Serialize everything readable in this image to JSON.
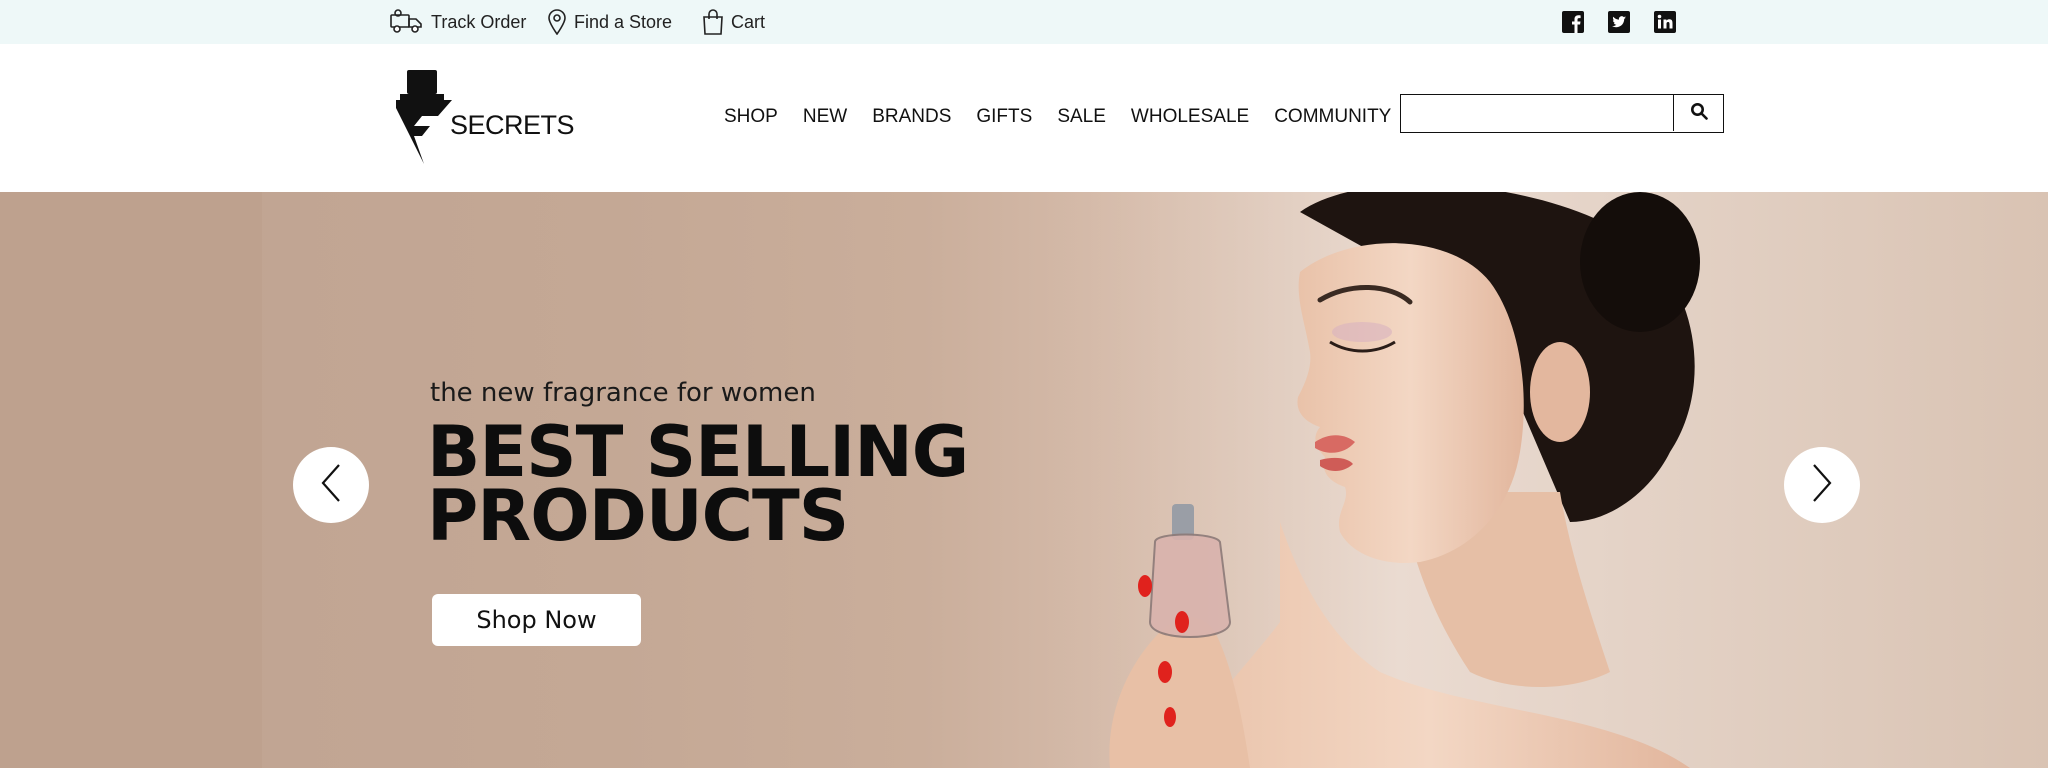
{
  "topbar": {
    "track_order": "Track Order",
    "find_store": "Find a Store",
    "cart": "Cart"
  },
  "header": {
    "logo_text": "SECRETS",
    "nav": [
      "SHOP",
      "NEW",
      "BRANDS",
      "GIFTS",
      "SALE",
      "WHOLESALE",
      "COMMUNITY"
    ],
    "search": {
      "placeholder": "",
      "value": ""
    }
  },
  "hero": {
    "subtitle": "the new fragrance for women",
    "headline_line1": "BEST SELLING",
    "headline_line2": "PRODUCTS",
    "cta": "Shop Now"
  },
  "icons": {
    "track": "truck-icon",
    "store": "map-pin-icon",
    "cart": "shopping-bag-icon",
    "facebook": "facebook-icon",
    "twitter": "twitter-icon",
    "linkedin": "linkedin-icon",
    "search": "search-icon",
    "prev": "chevron-left-icon",
    "next": "chevron-right-icon"
  },
  "colors": {
    "topbar_bg": "#eef8f8",
    "hero_bg": "#c4a895",
    "text": "#111111"
  }
}
